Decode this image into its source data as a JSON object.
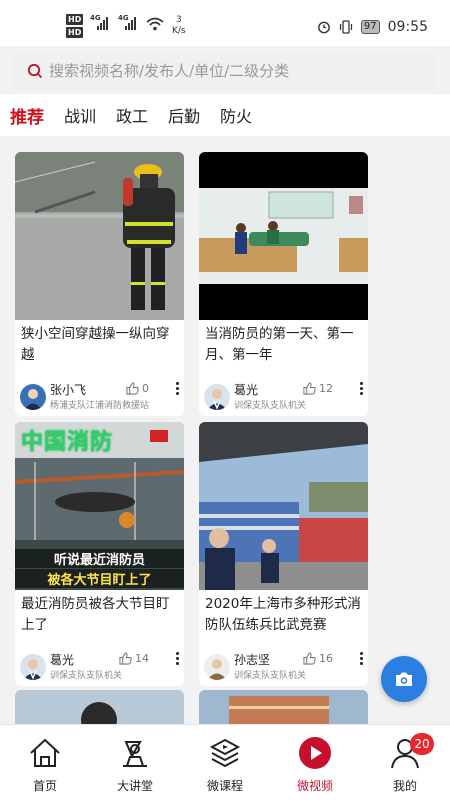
{
  "status_bar": {
    "hd1": "HD",
    "hd2": "HD",
    "net1": "4G",
    "net2": "4G",
    "speed_value": "3",
    "speed_unit": "K/s",
    "battery": "97",
    "time": "09:55"
  },
  "search": {
    "placeholder": "搜索视频名称/发布人/单位/二级分类"
  },
  "tabs": [
    {
      "label": "推荐",
      "active": true
    },
    {
      "label": "战训"
    },
    {
      "label": "政工"
    },
    {
      "label": "后勤"
    },
    {
      "label": "防火"
    }
  ],
  "videos": [
    {
      "title": "狭小空间穿越操一纵向穿越",
      "author": "张小飞",
      "unit": "杨浦支队江浦消防救援站",
      "likes": "0"
    },
    {
      "title": "当消防员的第一天、第一月、第一年",
      "author": "葛光",
      "unit": "训保支队支队机关",
      "likes": "12"
    },
    {
      "title": "最近消防员被各大节目盯上了",
      "author": "葛光",
      "unit": "训保支队支队机关",
      "likes": "14",
      "overlay": "中国消防",
      "caption1": "听说最近消防员",
      "caption2": "被各大节目盯上了"
    },
    {
      "title": "2020年上海市多种形式消防队伍练兵比武竞赛",
      "author": "孙志坚",
      "unit": "训保支队支队机关",
      "likes": "16"
    }
  ],
  "bottom_nav": [
    {
      "label": "首页",
      "icon": "home-icon"
    },
    {
      "label": "大讲堂",
      "icon": "lecture-icon"
    },
    {
      "label": "微课程",
      "icon": "course-icon"
    },
    {
      "label": "微视频",
      "icon": "video-icon",
      "active": true
    },
    {
      "label": "我的",
      "icon": "profile-icon",
      "badge": "20"
    }
  ],
  "colors": {
    "accent": "#d0101e",
    "fab": "#2a7fe0",
    "badge": "#e8262e"
  }
}
